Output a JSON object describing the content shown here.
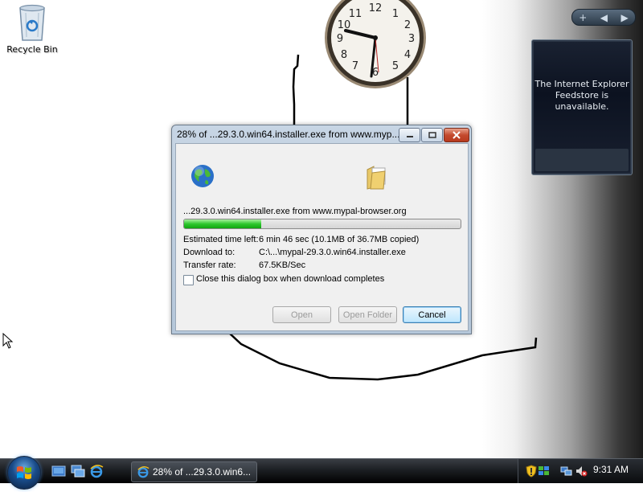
{
  "desktop": {
    "recycle_bin_label": "Recycle Bin"
  },
  "sidebar": {
    "controls": {
      "add": "+",
      "prev": "◀",
      "next": "▶"
    },
    "feed_message": "The Internet Explorer Feedstore is unavailable."
  },
  "clock_gadget": {
    "hour_marks": [
      "12",
      "1",
      "2",
      "3",
      "4",
      "5",
      "6",
      "7",
      "8",
      "9",
      "10",
      "11"
    ]
  },
  "dialog": {
    "title": "28% of ...29.3.0.win64.installer.exe from www.myp...",
    "source": "...29.3.0.win64.installer.exe from www.mypal-browser.org",
    "progress_percent": 28,
    "rows": [
      {
        "label": "Estimated time left:",
        "value": "6 min 46 sec (10.1MB of 36.7MB copied)"
      },
      {
        "label": "Download to:",
        "value": "C:\\...\\mypal-29.3.0.win64.installer.exe"
      },
      {
        "label": "Transfer rate:",
        "value": "67.5KB/Sec"
      }
    ],
    "close_when_done_label": "Close this dialog box when download completes",
    "close_when_done_checked": false,
    "buttons": {
      "open": "Open",
      "open_folder": "Open Folder",
      "cancel": "Cancel"
    }
  },
  "taskbar": {
    "active_task": "28% of ...29.3.0.win6...",
    "time": "9:31 AM"
  },
  "colors": {
    "progress_green": "#2ec82e",
    "taskbar": "#1c1f23",
    "dialog_frame": "#b5c7da"
  }
}
